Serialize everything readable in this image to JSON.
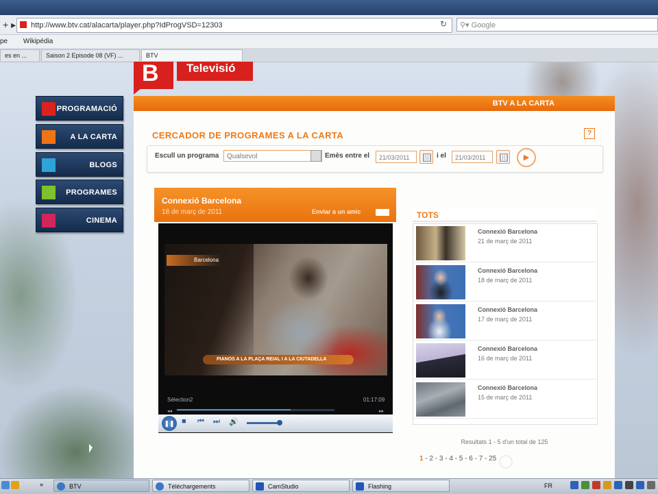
{
  "browser": {
    "url": "http://www.btv.cat/alacarta/player.php?IdProgVSD=12303",
    "search_placeholder": "Google",
    "bookmarks": [
      "pe",
      "Wikipédia"
    ],
    "tabs": [
      "es en ...",
      "Saison 2 Episode 08 (VF) ...",
      "BTV"
    ]
  },
  "site": {
    "logo_letter": "B",
    "logo_text": "Televisió",
    "header_label": "BTV A LA CARTA",
    "nav": [
      {
        "label": "PROGRAMACIÓ",
        "color": "#d9231c"
      },
      {
        "label": "A LA CARTA",
        "color": "#f07416"
      },
      {
        "label": "BLOGS",
        "color": "#2ea3d8"
      },
      {
        "label": "PROGRAMES",
        "color": "#7dc12d"
      },
      {
        "label": "CINEMA",
        "color": "#d2255a"
      }
    ]
  },
  "search": {
    "title": "CERCADOR DE PROGRAMES A LA CARTA",
    "help": "?",
    "program_label": "Escull un programa",
    "program_value": "Qualsevol",
    "between_label": "Emès entre el",
    "date_from": "21/03/2011",
    "and_label": "i el",
    "date_to": "21/03/2011"
  },
  "video": {
    "title": "Connexió Barcelona",
    "date": "18 de març de 2011",
    "send_link": "Enviar a un amic",
    "overlay_logo": "Barcelona",
    "lower_third": "PIANOS A LA PLAÇA REIAL I A LA CIUTADELLA",
    "player_info": "Sélection2",
    "player_time": "01:17:09",
    "progress_fraction": 0.72,
    "volume_fraction": 0.85
  },
  "list": {
    "heading": "TOTS",
    "items": [
      {
        "title": "Connexió Barcelona",
        "date": "21 de març de 2011",
        "thumb": "street-scene"
      },
      {
        "title": "Connexió Barcelona",
        "date": "18 de març de 2011",
        "thumb": "presenter"
      },
      {
        "title": "Connexió Barcelona",
        "date": "17 de març de 2011",
        "thumb": "presenter"
      },
      {
        "title": "Connexió Barcelona",
        "date": "16 de març de 2011",
        "thumb": "train"
      },
      {
        "title": "Connexió Barcelona",
        "date": "15 de març de 2011",
        "thumb": "aerial"
      }
    ],
    "results_text": "Resultats 1 - 5 d'un total de 125",
    "current_page": "1",
    "pages": "- 2 - 3 - 4 - 5 - 6 - 7 - 25"
  },
  "taskbar": {
    "items": [
      "BTV",
      "Téléchargements",
      "CamStudio",
      "Flashing"
    ],
    "language": "FR"
  }
}
